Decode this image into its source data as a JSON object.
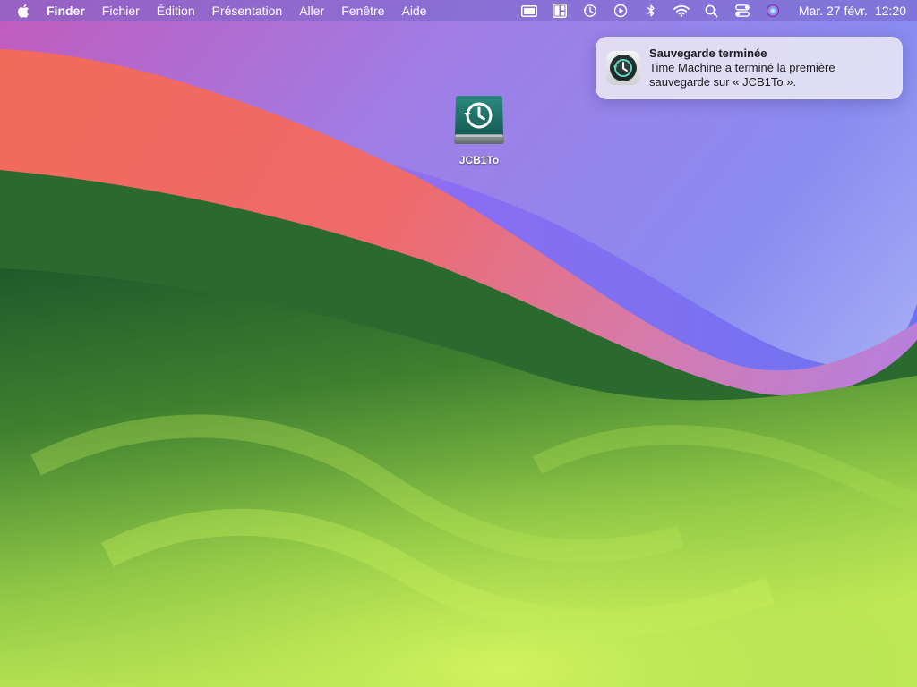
{
  "menubar": {
    "app_name": "Finder",
    "menus": [
      "Fichier",
      "Édition",
      "Présentation",
      "Aller",
      "Fenêtre",
      "Aide"
    ],
    "status_icons": [
      "display-icon",
      "window-layout-icon",
      "time-machine-icon",
      "play-icon",
      "bluetooth-icon",
      "wifi-icon",
      "search-icon",
      "control-center-icon",
      "siri-icon"
    ],
    "date": "Mar. 27 févr.",
    "time": "12:20"
  },
  "notification": {
    "title": "Sauvegarde terminée",
    "body_line1": "Time Machine a terminé la première",
    "body_line2": "sauvegarde sur « JCB1To ».",
    "icon": "time-machine-icon"
  },
  "desktop": {
    "drive_label": "JCB1To",
    "drive_icon": "time-machine-drive-icon"
  },
  "colors": {
    "menubar": "#7864c8",
    "notification_bg": "#ebe8f5",
    "drive_teal": "#1f6b63"
  }
}
